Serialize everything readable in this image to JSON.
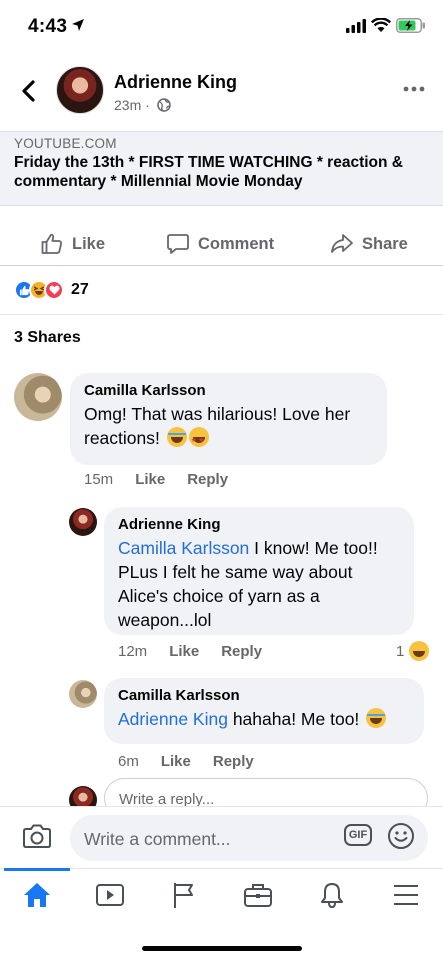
{
  "status_bar": {
    "time": "4:43"
  },
  "post": {
    "author": "Adrienne King",
    "time": "23m",
    "meta_separator": "·",
    "link": {
      "domain": "YOUTUBE.COM",
      "title": "Friday the 13th * FIRST TIME WATCHING * reaction & commentary * Millennial Movie Monday"
    },
    "actions": {
      "like": "Like",
      "comment": "Comment",
      "share": "Share"
    },
    "reaction_count": "27",
    "shares": "3 Shares"
  },
  "comments": [
    {
      "author": "Camilla Karlsson",
      "text": "Omg! That was hilarious! Love her reactions!",
      "emojis": [
        "laughing-tears-emoji",
        "star-struck-emoji"
      ],
      "time": "15m",
      "like": "Like",
      "reply": "Reply"
    },
    {
      "author": "Adrienne King",
      "mention": "Camilla Karlsson",
      "text": " I know! Me too!! PLus I felt he same way about Alice's choice of yarn as a weapon...lol",
      "time": "12m",
      "like": "Like",
      "reply": "Reply",
      "reaction_count": "1"
    },
    {
      "author": "Camilla Karlsson",
      "mention": "Adrienne King",
      "text": " hahaha! Me too!",
      "emojis": [
        "rofl-emoji"
      ],
      "time": "6m",
      "like": "Like",
      "reply": "Reply"
    }
  ],
  "reply_placeholder": "Write a reply...",
  "composer": {
    "placeholder": "Write a comment...",
    "gif": "GIF"
  },
  "colors": {
    "accent": "#1877f2",
    "mention": "#216fdb",
    "bubble": "#f0f2f5",
    "muted": "#65676b"
  },
  "tabs": [
    "home-icon",
    "video-icon",
    "pages-flag-icon",
    "marketplace-icon",
    "notifications-bell-icon",
    "menu-icon"
  ]
}
